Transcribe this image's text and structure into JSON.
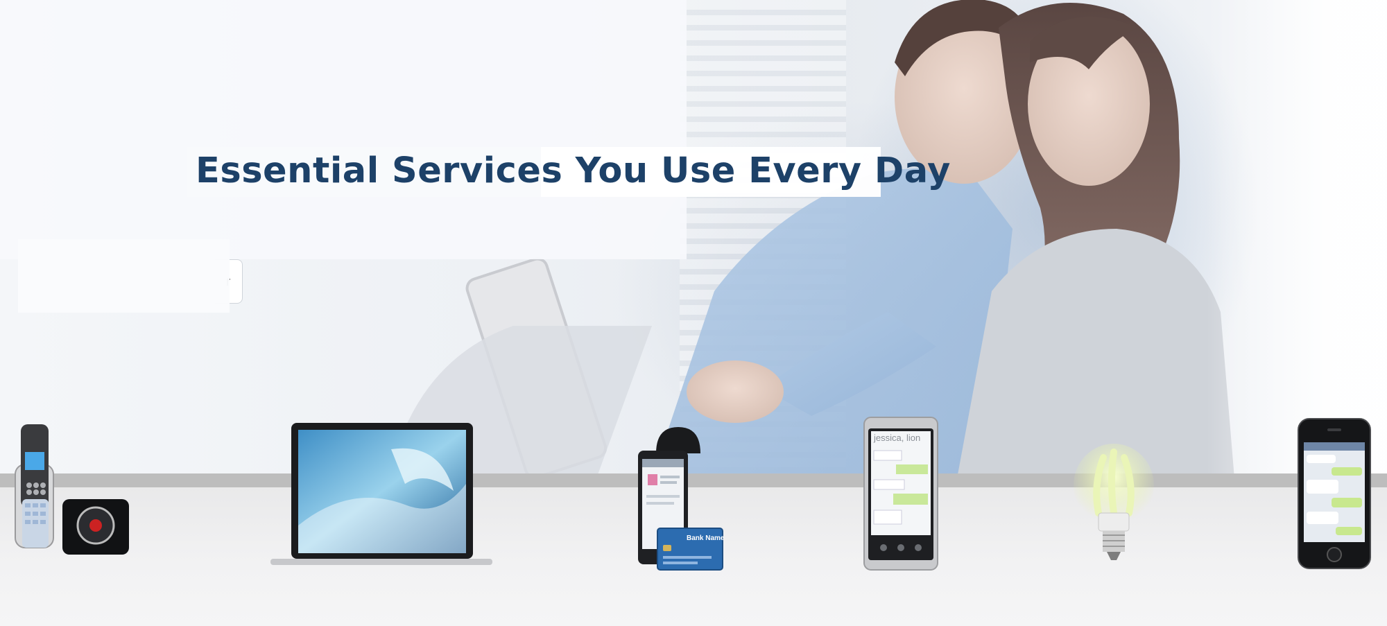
{
  "hero": {
    "headline_part1": "Essential Services",
    "headline_part2": "You Use Every Day"
  },
  "cta": {
    "button_label": "r"
  },
  "devices": [
    {
      "icon": "cordless-phone-icon"
    },
    {
      "icon": "laptop-icon"
    },
    {
      "icon": "card-reader-phone-icon"
    },
    {
      "icon": "smartphone-messaging-icon"
    },
    {
      "icon": "light-bulb-icon"
    },
    {
      "icon": "iphone-icon"
    }
  ],
  "device_screens": {
    "card_label": "Bank Name",
    "nokia_header": "jessica, lion"
  },
  "colors": {
    "headline": "#1d4168",
    "shelf_rail": "#bdbdbd",
    "card_blue": "#2c6cb0"
  }
}
